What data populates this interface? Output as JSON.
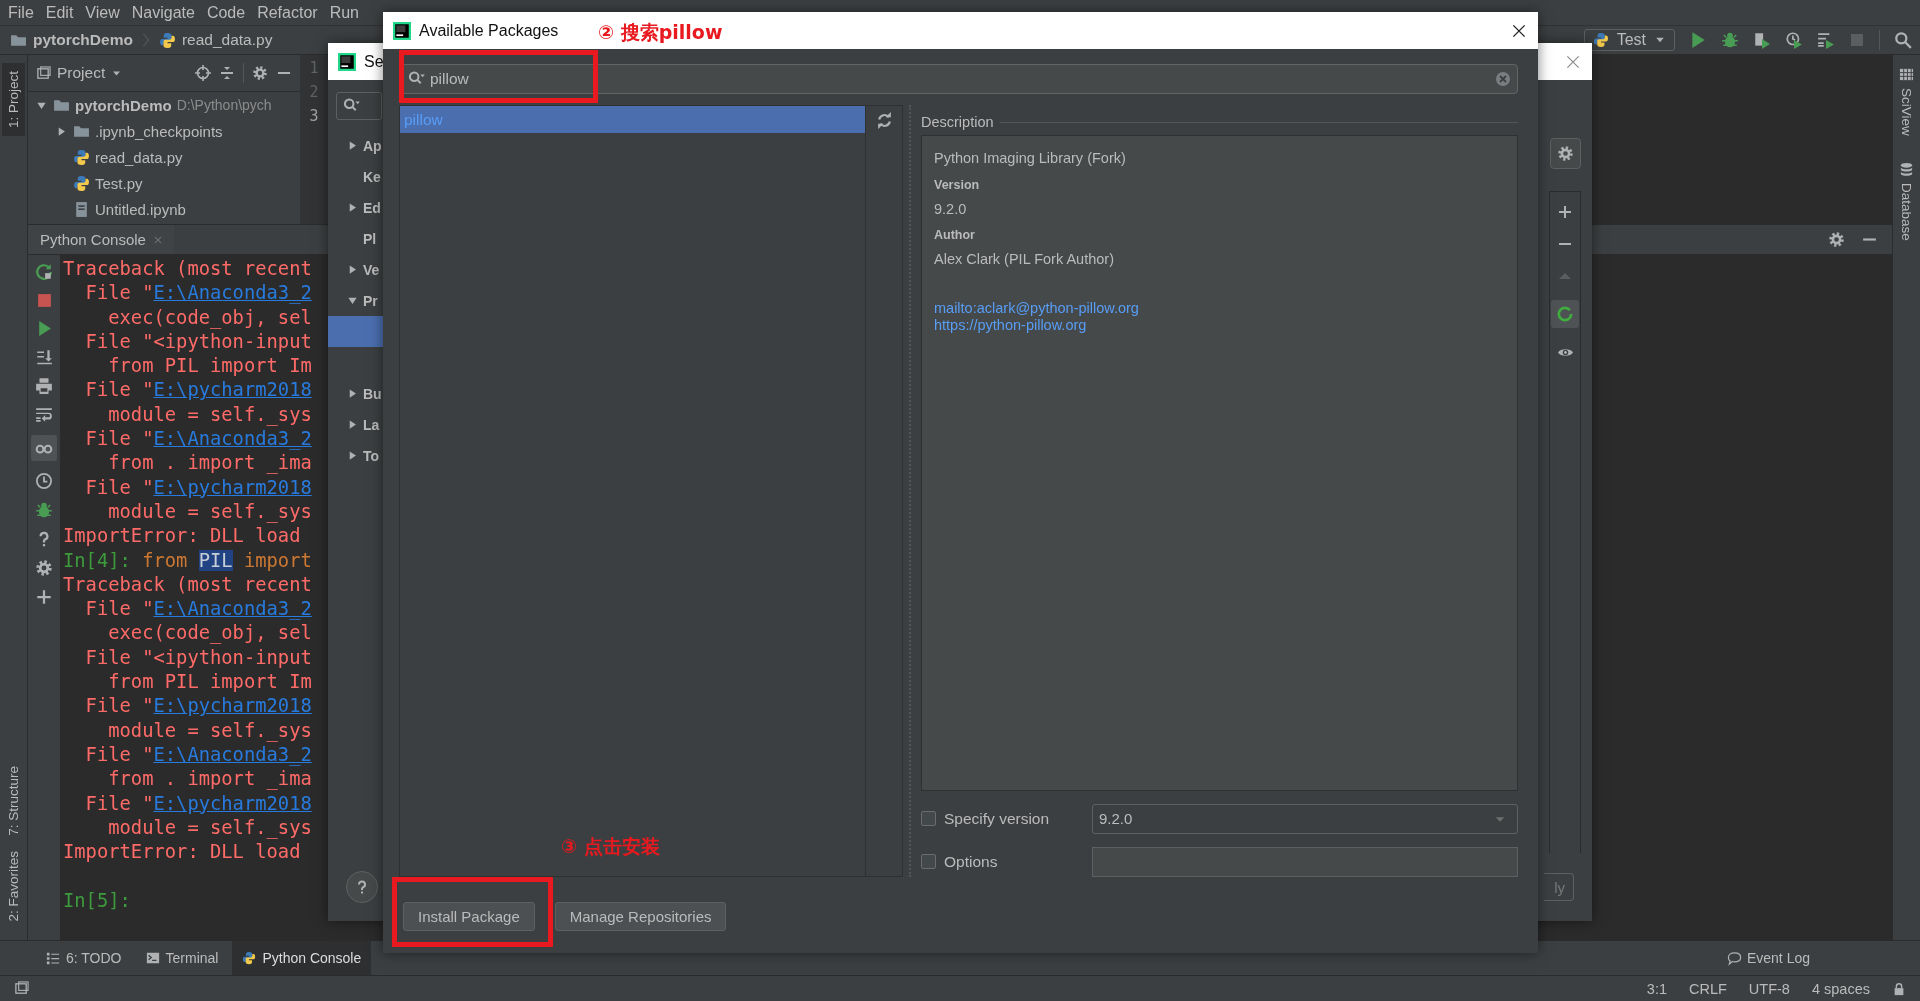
{
  "menu_bar": [
    "File",
    "Edit",
    "View",
    "Navigate",
    "Code",
    "Refactor",
    "Run"
  ],
  "breadcrumbs": [
    "pytorchDemo",
    "read_data.py"
  ],
  "run_config": "Test",
  "left_strip": [
    {
      "label": "1: Project",
      "selected": true
    },
    {
      "label": "7: Structure",
      "selected": false
    },
    {
      "label": "2: Favorites",
      "selected": false
    }
  ],
  "right_strip": [
    "SciView",
    "Database"
  ],
  "project_panel": {
    "title": "Project",
    "tree": [
      {
        "label": "pytorchDemo",
        "path": "D:\\Python\\pych",
        "kind": "folder",
        "expanded": true,
        "children": [
          {
            "label": ".ipynb_checkpoints",
            "kind": "folder",
            "expanded": false
          },
          {
            "label": "read_data.py",
            "kind": "python"
          },
          {
            "label": "Test.py",
            "kind": "python"
          },
          {
            "label": "Untitled.ipynb",
            "kind": "notebook"
          }
        ]
      }
    ]
  },
  "editor": {
    "line_numbers": [
      "1",
      "2",
      "3"
    ]
  },
  "console": {
    "tab": "Python Console",
    "lines": [
      {
        "parts": [
          {
            "text": "Traceback (most recent",
            "kind": "error"
          }
        ]
      },
      {
        "parts": [
          {
            "text": "  File \"",
            "kind": "error"
          },
          {
            "text": "E:\\Anaconda3_2",
            "kind": "link"
          }
        ]
      },
      {
        "parts": [
          {
            "text": "    exec(code_obj, sel",
            "kind": "error"
          }
        ]
      },
      {
        "parts": [
          {
            "text": "  File \"<ipython-input",
            "kind": "error"
          }
        ]
      },
      {
        "parts": [
          {
            "text": "    from PIL import Im",
            "kind": "error"
          }
        ]
      },
      {
        "parts": [
          {
            "text": "  File \"",
            "kind": "error"
          },
          {
            "text": "E:\\pycharm2018",
            "kind": "link"
          }
        ]
      },
      {
        "parts": [
          {
            "text": "    module = self._sys",
            "kind": "error"
          }
        ]
      },
      {
        "parts": [
          {
            "text": "  File \"",
            "kind": "error"
          },
          {
            "text": "E:\\Anaconda3_2",
            "kind": "link"
          }
        ]
      },
      {
        "parts": [
          {
            "text": "    from . import _ima",
            "kind": "error"
          }
        ]
      },
      {
        "parts": [
          {
            "text": "  File \"",
            "kind": "error"
          },
          {
            "text": "E:\\pycharm2018",
            "kind": "link"
          }
        ]
      },
      {
        "parts": [
          {
            "text": "    module = self._sys",
            "kind": "error"
          }
        ]
      },
      {
        "parts": [
          {
            "text": "ImportError: DLL load",
            "kind": "error"
          }
        ]
      },
      {
        "parts": [
          {
            "text": "In[4]: ",
            "kind": "prompt"
          },
          {
            "text": "from ",
            "kind": "code"
          },
          {
            "text": "PIL",
            "kind": "selection"
          },
          {
            "text": " import",
            "kind": "code"
          }
        ]
      },
      {
        "parts": [
          {
            "text": "Traceback (most recent",
            "kind": "error"
          }
        ]
      },
      {
        "parts": [
          {
            "text": "  File \"",
            "kind": "error"
          },
          {
            "text": "E:\\Anaconda3_2",
            "kind": "link"
          }
        ]
      },
      {
        "parts": [
          {
            "text": "    exec(code_obj, sel",
            "kind": "error"
          }
        ]
      },
      {
        "parts": [
          {
            "text": "  File \"<ipython-input",
            "kind": "error"
          }
        ]
      },
      {
        "parts": [
          {
            "text": "    from PIL import Im",
            "kind": "error"
          }
        ]
      },
      {
        "parts": [
          {
            "text": "  File \"",
            "kind": "error"
          },
          {
            "text": "E:\\pycharm2018",
            "kind": "link"
          }
        ]
      },
      {
        "parts": [
          {
            "text": "    module = self._sys",
            "kind": "error"
          }
        ]
      },
      {
        "parts": [
          {
            "text": "  File \"",
            "kind": "error"
          },
          {
            "text": "E:\\Anaconda3_2",
            "kind": "link"
          }
        ]
      },
      {
        "parts": [
          {
            "text": "    from . import _ima",
            "kind": "error"
          }
        ]
      },
      {
        "parts": [
          {
            "text": "  File \"",
            "kind": "error"
          },
          {
            "text": "E:\\pycharm2018",
            "kind": "link"
          }
        ]
      },
      {
        "parts": [
          {
            "text": "    module = self._sys",
            "kind": "error"
          }
        ]
      },
      {
        "parts": [
          {
            "text": "ImportError: DLL load",
            "kind": "error"
          }
        ]
      },
      {
        "parts": [
          {
            "text": "In[5]:",
            "kind": "prompt"
          }
        ],
        "gap_before": true
      }
    ]
  },
  "settings_dialog": {
    "title": "Se",
    "tree": [
      {
        "label": "Ap",
        "expanded": false,
        "selected": false
      },
      {
        "label": "Ke",
        "selected": false
      },
      {
        "label": "Ed",
        "expanded": false,
        "selected": false
      },
      {
        "label": "Pl",
        "selected": false
      },
      {
        "label": "Ve",
        "expanded": false,
        "selected": false
      },
      {
        "label": "Pr",
        "expanded": true,
        "selected": false,
        "children": [
          {
            "selected": true
          },
          {
            "selected": false
          }
        ]
      },
      {
        "label": "Bu",
        "expanded": false,
        "selected": false
      },
      {
        "label": "La",
        "expanded": false,
        "selected": false
      },
      {
        "label": "To",
        "expanded": false,
        "selected": false
      }
    ],
    "apply_button": "ly"
  },
  "packages_dialog": {
    "title": "Available Packages",
    "search": {
      "value": "pillow"
    },
    "packages": [
      {
        "name": "pillow",
        "selected": true
      }
    ],
    "description_label": "Description",
    "details": {
      "summary": "Python Imaging Library (Fork)",
      "fields": [
        {
          "label": "Version",
          "value": "9.2.0"
        },
        {
          "label": "Author",
          "value": "Alex Clark (PIL Fork Author)"
        }
      ],
      "links": [
        "mailto:aclark@python-pillow.org",
        "https://python-pillow.org"
      ]
    },
    "specify_version": {
      "label": "Specify version",
      "checked": false,
      "value": "9.2.0"
    },
    "options": {
      "label": "Options",
      "checked": false
    },
    "buttons": [
      "Install Package",
      "Manage Repositories"
    ],
    "annotations": [
      "② 搜索pillow",
      "③ 点击安装"
    ]
  },
  "bottom_tabs": [
    {
      "label": "6: TODO",
      "kind": "todo",
      "selected": false
    },
    {
      "label": "Terminal",
      "kind": "terminal",
      "selected": false
    },
    {
      "label": "Python Console",
      "kind": "console",
      "selected": true
    }
  ],
  "event_log": "Event Log",
  "status_bar": [
    "3:1",
    "CRLF",
    "UTF-8",
    "4 spaces"
  ]
}
